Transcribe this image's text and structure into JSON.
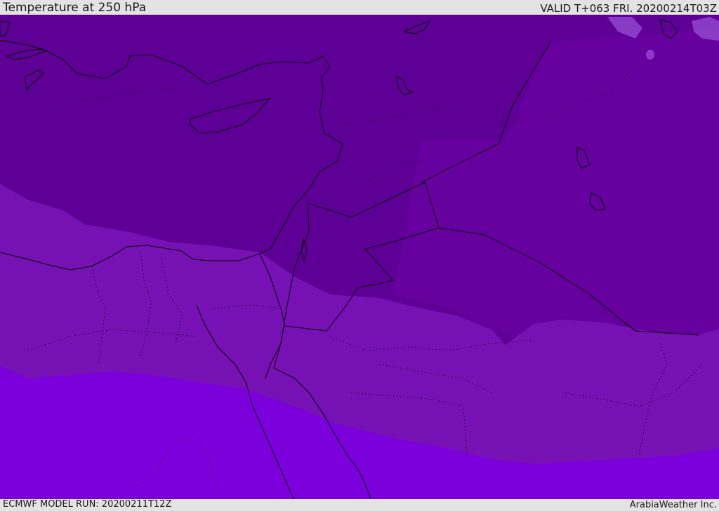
{
  "header": {
    "title": "Temperature at 250 hPa",
    "valid": "VALID T+063 FRI. 20200214T03Z"
  },
  "footer": {
    "model_run": "ECMWF MODEL RUN: 20200211T12Z",
    "credit": "ArabiaWeather Inc."
  },
  "map": {
    "colors": {
      "coldest_band": "#5e0096",
      "cold_band": "#66009e",
      "mid_band": "#7611b3",
      "warm_band": "#7c00dc",
      "pale_patch": "#9a4fd4",
      "coastline": "#000000"
    }
  }
}
